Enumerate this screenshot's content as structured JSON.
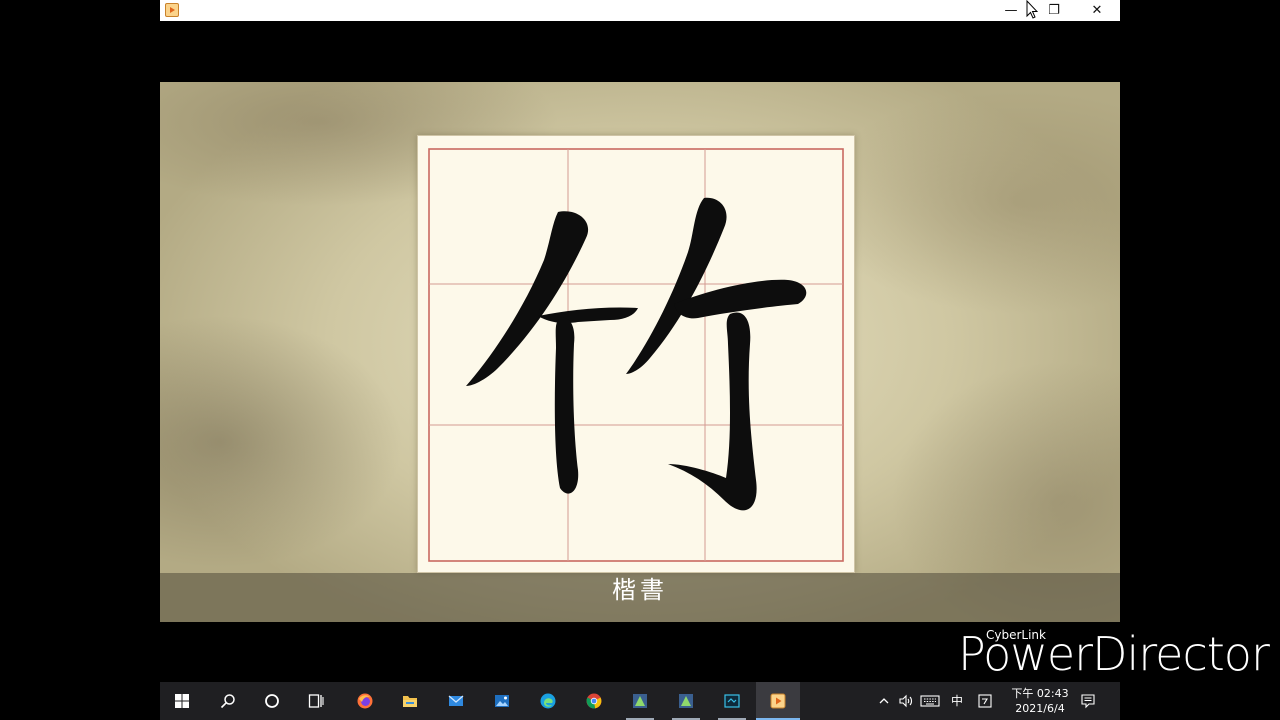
{
  "window": {
    "title": "",
    "controls": {
      "minimize": "—",
      "maximize": "❐",
      "close": "✕"
    }
  },
  "video": {
    "character": "竹",
    "caption": "楷書"
  },
  "watermark": {
    "brand": "CyberLink",
    "product": "PowerDirector"
  },
  "taskbar": {
    "apps": [
      {
        "name": "start",
        "icon": "windows-icon"
      },
      {
        "name": "search",
        "icon": "search-icon"
      },
      {
        "name": "cortana",
        "icon": "cortana-icon"
      },
      {
        "name": "task-view",
        "icon": "task-view-icon"
      },
      {
        "name": "firefox",
        "icon": "firefox-icon"
      },
      {
        "name": "file-explorer",
        "icon": "folder-icon"
      },
      {
        "name": "mail",
        "icon": "mail-icon"
      },
      {
        "name": "photos",
        "icon": "photos-icon"
      },
      {
        "name": "edge",
        "icon": "edge-icon"
      },
      {
        "name": "chrome",
        "icon": "chrome-icon"
      },
      {
        "name": "app-1",
        "icon": "app-green-icon"
      },
      {
        "name": "app-2",
        "icon": "app-green-icon"
      },
      {
        "name": "app-3",
        "icon": "screen-capture-icon"
      },
      {
        "name": "powerdirector",
        "icon": "powerdirector-icon"
      }
    ],
    "tray": {
      "ime": "中",
      "time": "下午 02:43",
      "date": "2021/6/4"
    }
  },
  "colors": {
    "grid_line": "#c96a60",
    "ink": "#0d0d0d",
    "taskbar": "#1f1f22",
    "accent": "#7cb7f0"
  }
}
